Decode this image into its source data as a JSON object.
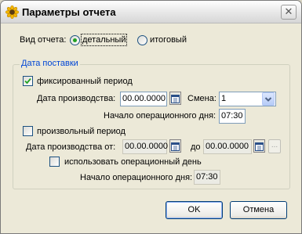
{
  "window": {
    "title": "Параметры отчета",
    "close_symbol": "✕",
    "icon": "sunflower-icon"
  },
  "report_type": {
    "label": "Вид отчета:",
    "options": [
      {
        "label": "детальный",
        "selected": true
      },
      {
        "label": "итоговый",
        "selected": false
      }
    ]
  },
  "delivery_group": {
    "title": "Дата поставки",
    "fixed_period": {
      "label": "фиксированный период",
      "checked": true,
      "date_label": "Дата производства:",
      "date_value": "00.00.0000",
      "shift_label": "Смена:",
      "shift_value": "1",
      "day_start_label": "Начало операционного дня:",
      "day_start_value": "07:30"
    },
    "custom_period": {
      "label": "произвольный период",
      "checked": false,
      "date_from_label": "Дата производства от:",
      "date_from_value": "00.00.0000",
      "date_to_label": "до",
      "date_to_value": "00.00.0000",
      "ellipsis": "...",
      "use_operational_day_label": "использовать операционный день",
      "use_operational_day_checked": false,
      "day_start_label": "Начало операционного дня:",
      "day_start_value": "07:30"
    }
  },
  "buttons": {
    "ok": "OK",
    "cancel": "Отмена"
  },
  "colors": {
    "accent_group_title": "#0046d5",
    "window_bg": "#ece9d8",
    "radio_selected": "#21a121",
    "checkbox_tick": "#21a121"
  }
}
